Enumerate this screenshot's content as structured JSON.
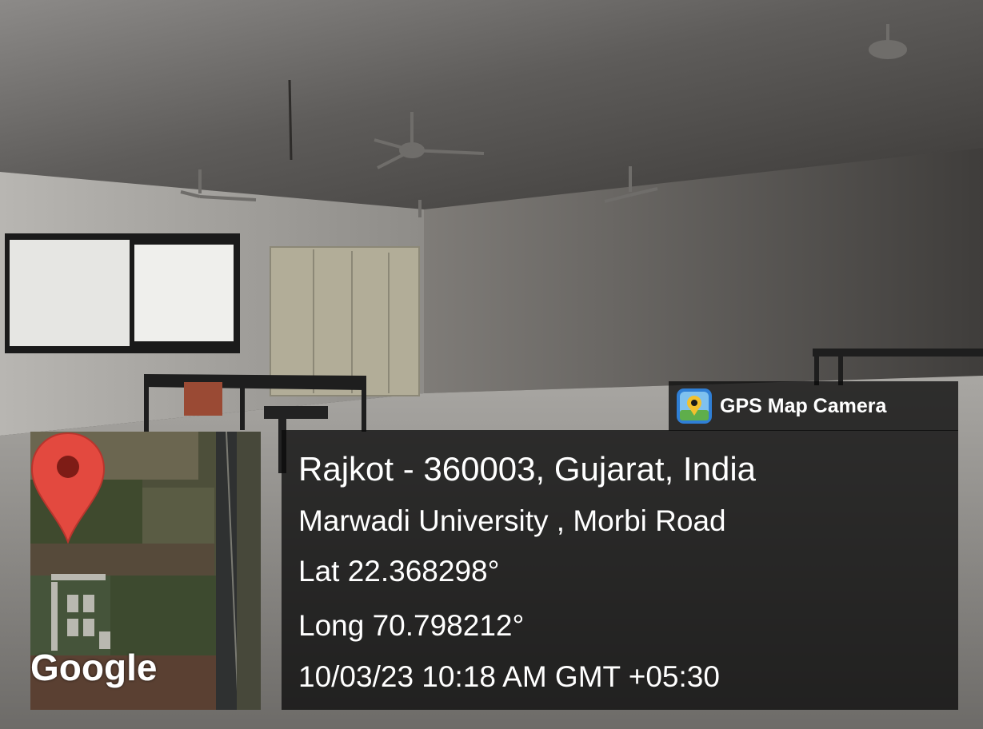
{
  "photo": {
    "subject": "empty room with ceiling fans, table, stools and window"
  },
  "brand": {
    "label": "GPS Map Camera",
    "icon": "map-camera-icon"
  },
  "location": {
    "city_line": "Rajkot - 360003, Gujarat, India",
    "address_line": "Marwadi University , Morbi Road",
    "latitude": "Lat 22.368298°",
    "longitude": "Long 70.798212°",
    "timestamp": "10/03/23 10:18 AM GMT +05:30"
  },
  "map": {
    "logo": "Google",
    "pin_icon": "map-pin-icon",
    "pin_color": "#e3493f"
  }
}
